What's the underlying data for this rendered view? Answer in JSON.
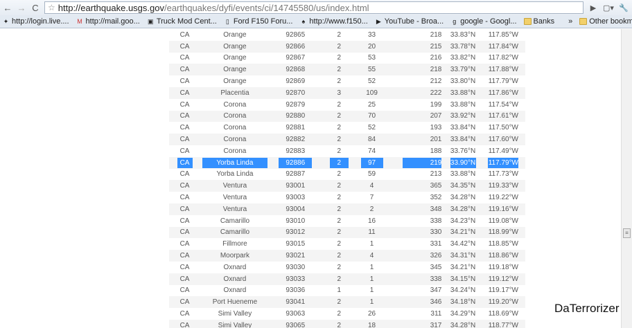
{
  "browser": {
    "url_host": "http://earthquake.usgs.gov",
    "url_path": "/earthquakes/dyfi/events/ci/14745580/us/index.html",
    "bookmarks": [
      "http://login.live....",
      "http://mail.goo...",
      "Truck Mod Cent...",
      "Ford F150 Foru...",
      "http://www.f150...",
      "YouTube - Broa...",
      "google - Googl...",
      "Banks"
    ],
    "overflow": "»",
    "other_bookmarks": "Other bookmarks"
  },
  "table": {
    "selected_index": 11,
    "rows": [
      [
        "CA",
        "Orange",
        "92865",
        "2",
        "33",
        "218",
        "33.83°N",
        "117.85°W"
      ],
      [
        "CA",
        "Orange",
        "92866",
        "2",
        "20",
        "215",
        "33.78°N",
        "117.84°W"
      ],
      [
        "CA",
        "Orange",
        "92867",
        "2",
        "53",
        "216",
        "33.82°N",
        "117.82°W"
      ],
      [
        "CA",
        "Orange",
        "92868",
        "2",
        "55",
        "218",
        "33.79°N",
        "117.88°W"
      ],
      [
        "CA",
        "Orange",
        "92869",
        "2",
        "52",
        "212",
        "33.80°N",
        "117.79°W"
      ],
      [
        "CA",
        "Placentia",
        "92870",
        "3",
        "109",
        "222",
        "33.88°N",
        "117.86°W"
      ],
      [
        "CA",
        "Corona",
        "92879",
        "2",
        "25",
        "199",
        "33.88°N",
        "117.54°W"
      ],
      [
        "CA",
        "Corona",
        "92880",
        "2",
        "70",
        "207",
        "33.92°N",
        "117.61°W"
      ],
      [
        "CA",
        "Corona",
        "92881",
        "2",
        "52",
        "193",
        "33.84°N",
        "117.50°W"
      ],
      [
        "CA",
        "Corona",
        "92882",
        "2",
        "84",
        "201",
        "33.84°N",
        "117.60°W"
      ],
      [
        "CA",
        "Corona",
        "92883",
        "2",
        "74",
        "188",
        "33.76°N",
        "117.49°W"
      ],
      [
        "CA",
        "Yorba Linda",
        "92886",
        "2",
        "97",
        "219",
        "33.90°N",
        "117.79°W"
      ],
      [
        "CA",
        "Yorba Linda",
        "92887",
        "2",
        "59",
        "213",
        "33.88°N",
        "117.73°W"
      ],
      [
        "CA",
        "Ventura",
        "93001",
        "2",
        "4",
        "365",
        "34.35°N",
        "119.33°W"
      ],
      [
        "CA",
        "Ventura",
        "93003",
        "2",
        "7",
        "352",
        "34.28°N",
        "119.22°W"
      ],
      [
        "CA",
        "Ventura",
        "93004",
        "2",
        "2",
        "348",
        "34.28°N",
        "119.16°W"
      ],
      [
        "CA",
        "Camarillo",
        "93010",
        "2",
        "16",
        "338",
        "34.23°N",
        "119.08°W"
      ],
      [
        "CA",
        "Camarillo",
        "93012",
        "2",
        "11",
        "330",
        "34.21°N",
        "118.99°W"
      ],
      [
        "CA",
        "Fillmore",
        "93015",
        "2",
        "1",
        "331",
        "34.42°N",
        "118.85°W"
      ],
      [
        "CA",
        "Moorpark",
        "93021",
        "2",
        "4",
        "326",
        "34.31°N",
        "118.86°W"
      ],
      [
        "CA",
        "Oxnard",
        "93030",
        "2",
        "1",
        "345",
        "34.21°N",
        "119.18°W"
      ],
      [
        "CA",
        "Oxnard",
        "93033",
        "2",
        "1",
        "338",
        "34.15°N",
        "119.12°W"
      ],
      [
        "CA",
        "Oxnard",
        "93036",
        "1",
        "1",
        "347",
        "34.24°N",
        "119.17°W"
      ],
      [
        "CA",
        "Port Hueneme",
        "93041",
        "2",
        "1",
        "346",
        "34.18°N",
        "119.20°W"
      ],
      [
        "CA",
        "Simi Valley",
        "93063",
        "2",
        "26",
        "311",
        "34.29°N",
        "118.69°W"
      ],
      [
        "CA",
        "Simi Valley",
        "93065",
        "2",
        "18",
        "317",
        "34.28°N",
        "118.77°W"
      ]
    ]
  },
  "watermark": "DaTerrorizer"
}
